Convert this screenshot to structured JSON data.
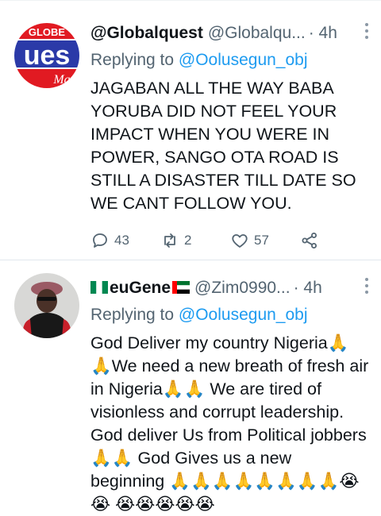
{
  "tweets": [
    {
      "display_name": "@Globalquest",
      "handle": "@Globalqu...",
      "time": "· 4h",
      "replying_prefix": "Replying to ",
      "replying_to": "@Oolusegun_obj",
      "body": "JAGABAN ALL THE WAY BABA YORUBA DID NOT FEEL YOUR IMPACT WHEN YOU WERE IN POWER, SANGO OTA ROAD IS STILL A DISASTER TILL DATE SO WE CANT FOLLOW YOU.",
      "replies": "43",
      "retweets": "2",
      "likes": "57",
      "avatar_lines": [
        "GLOBE",
        "ues",
        "Ma"
      ]
    },
    {
      "display_name": "euGene",
      "handle": "@Zim0990...",
      "time": "· 4h",
      "replying_prefix": "Replying to ",
      "replying_to": "@Oolusegun_obj",
      "body": "God Deliver my country Nigeria🙏 🙏We need a new breath of fresh air in Nigeria🙏🙏 We are tired of visionless and corrupt leadership. God deliver Us from Political jobbers🙏🙏 God Gives us a new beginning 🙏🙏🙏🙏🙏🙏🙏🙏😭😭 😭😭😭😭😭"
    }
  ],
  "colors": {
    "link": "#1d9bf0",
    "muted": "#536471",
    "text": "#0f1419"
  },
  "icons": [
    "more-icon",
    "reply-icon",
    "retweet-icon",
    "like-icon",
    "share-icon",
    "nigeria-flag-icon",
    "uae-flag-icon"
  ]
}
